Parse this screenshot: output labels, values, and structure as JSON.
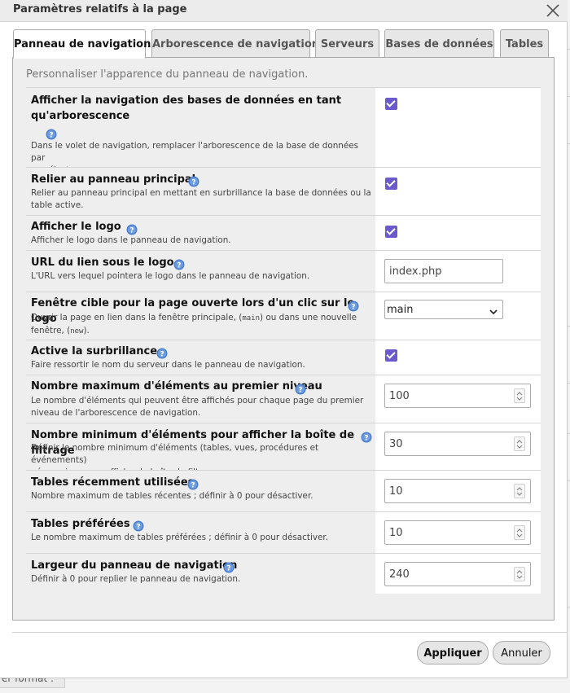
{
  "dialog": {
    "title": "Paramètres relatifs à la page",
    "close_icon": "close-icon"
  },
  "tabs": [
    {
      "label": "Panneau de navigation",
      "active": true
    },
    {
      "label": "Arborescence de navigation",
      "active": false
    },
    {
      "label": "Serveurs",
      "active": false
    },
    {
      "label": "Bases de données",
      "active": false
    },
    {
      "label": "Tables",
      "active": false
    }
  ],
  "intro": "Personnaliser l'apparence du panneau de navigation.",
  "settings": {
    "tree": {
      "title_line1": "Afficher la navigation des bases de données en tant",
      "title_line2": "qu'arborescence",
      "desc_line1": "Dans le volet de navigation, remplacer l'arborescence de la base de données par",
      "desc_line2": "un sélecteur",
      "checked": true
    },
    "link_main": {
      "title": "Relier au panneau principal",
      "desc_line1": "Relier au panneau principal en mettant en surbrillance la base de données ou la",
      "desc_line2": "table active.",
      "checked": true
    },
    "logo": {
      "title": "Afficher le logo",
      "desc": "Afficher le logo dans le panneau de navigation.",
      "checked": true
    },
    "logo_url": {
      "title": "URL du lien sous le logo",
      "desc": "L'URL vers lequel pointera le logo dans le panneau de navigation.",
      "value": "index.php"
    },
    "logo_target": {
      "title": "Fenêtre cible pour la page ouverte lors d'un clic sur le logo",
      "desc_part1": "Ouvrir la page en lien dans la fenêtre principale, (",
      "code1": "main",
      "desc_part2": ") ou dans une nouvelle",
      "desc_part3": "fenêtre, (",
      "code2": "new",
      "desc_part4": ").",
      "selected": "main"
    },
    "highlight": {
      "title": "Active la surbrillance",
      "desc": "Faire ressortir le nom du serveur dans le panneau de navigation.",
      "checked": true
    },
    "max_items": {
      "title": "Nombre maximum d'éléments au premier niveau",
      "desc_line1": "Le nombre d'éléments qui peuvent être affichés pour chaque page du premier",
      "desc_line2": "niveau de l'arborescence de navigation.",
      "value": "100"
    },
    "min_filter": {
      "title": "Nombre minimum d'éléments pour afficher la boîte de filtrage",
      "desc_line1": "Définir le nombre minimum d'éléments (tables, vues, procédures et événements)",
      "desc_line2": "nécessaires pour afficher la boîte de filtrage.",
      "value": "30"
    },
    "recent": {
      "title": "Tables récemment utilisées",
      "desc": "Nombre maximum de tables récentes ; définir à 0 pour désactiver.",
      "value": "10"
    },
    "favorite": {
      "title": "Tables préférées",
      "desc": "Le nombre maximum de tables préférées ; définir à 0 pour désactiver.",
      "value": "10"
    },
    "width": {
      "title": "Largeur du panneau de navigation",
      "desc": "Définir à 0 pour replier le panneau de navigation.",
      "value": "240"
    }
  },
  "buttons": {
    "apply": "Appliquer",
    "cancel": "Annuler"
  },
  "backdrop": {
    "button_fragment": "er format :"
  },
  "colors": {
    "checkbox": "#6a5acd",
    "help_icon": "#4a7fd0"
  }
}
